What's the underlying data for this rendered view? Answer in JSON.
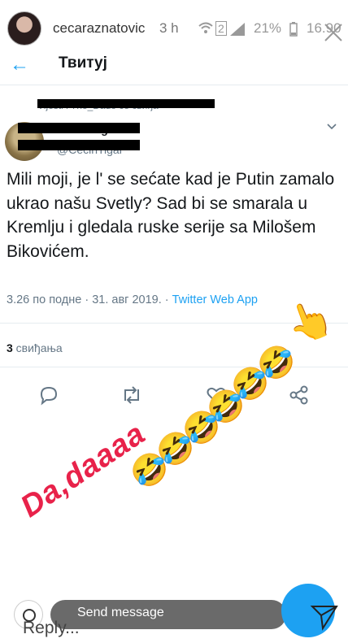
{
  "story": {
    "username": "cecaraznatovic",
    "time": "3 h",
    "sim": "2",
    "battery": "21%",
    "clock": "16.90"
  },
  "header": {
    "title": "Твитуј"
  },
  "tweet": {
    "retweet_note": "Vijesti i The_Dado се свиђа",
    "author_name": "Cecin Tigar",
    "author_handle": "@CecinTigar",
    "text": "Mili moji, je l' se sećate kad je Putin zamalo ukrao našu Svetly? Sad bi se smarala u Kremlju i gledala ruske serije sa Milošem Bikovićem.",
    "timestamp": "3.26 по подне · 31. авг 2019. · ",
    "source": "Twitter Web App",
    "likes_count": "3",
    "likes_label": " свиђања"
  },
  "overlay": {
    "emoji_laugh": "🤣",
    "emoji_point": "👆",
    "handwritten": "Da,daaaa"
  },
  "reply": {
    "send_placeholder": "Send message",
    "reply_placeholder": "Reply..."
  },
  "colors": {
    "twitter_blue": "#1da1f2",
    "muted_text": "#657786",
    "sticker_pink": "#e8224a"
  }
}
